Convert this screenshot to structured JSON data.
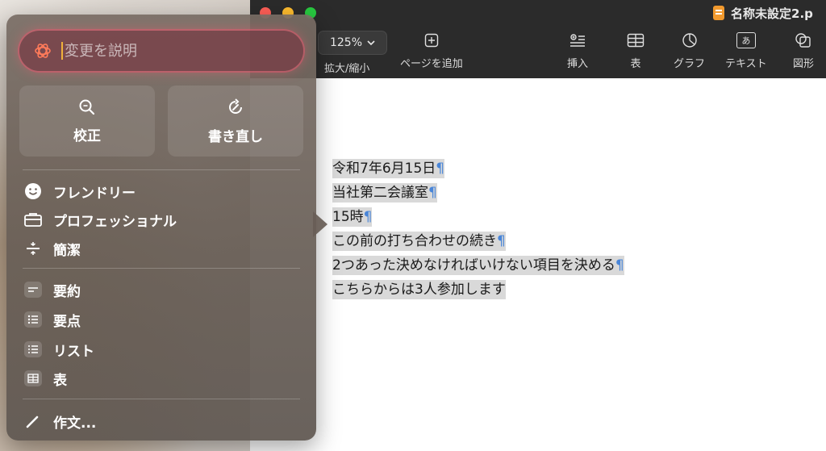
{
  "window": {
    "doc_title": "名称未設定2.p"
  },
  "toolbar": {
    "zoom_value": "125%",
    "zoom_label": "拡大/縮小",
    "add_page_label": "ページを追加",
    "insert_label": "挿入",
    "table_label": "表",
    "chart_label": "グラフ",
    "text_label": "テキスト",
    "shape_label": "図形",
    "text_icon_glyph": "あ"
  },
  "document": {
    "lines": [
      "令和7年6月15日",
      "当社第二会議室",
      "15時",
      "この前の打ち合わせの続き",
      "2つあった決めなければいけない項目を決める",
      "こちらからは3人参加します"
    ],
    "pilcrow": "¶"
  },
  "writing_tools": {
    "prompt_placeholder": "変更を説明",
    "proofread_label": "校正",
    "rewrite_label": "書き直し",
    "tone_items": [
      {
        "label": "フレンドリー",
        "icon": "smiley-icon"
      },
      {
        "label": "プロフェッショナル",
        "icon": "briefcase-icon"
      },
      {
        "label": "簡潔",
        "icon": "divide-icon"
      }
    ],
    "format_items": [
      {
        "label": "要約",
        "icon": "summary-icon"
      },
      {
        "label": "要点",
        "icon": "key-points-icon"
      },
      {
        "label": "リスト",
        "icon": "list-icon"
      },
      {
        "label": "表",
        "icon": "table-icon"
      }
    ],
    "compose_label": "作文..."
  },
  "colors": {
    "toolbar_bg": "#2b2b2b",
    "pilcrow": "#4a86d8",
    "highlight": "#d9d9d9",
    "prompt_glow": "#ff5a6e"
  }
}
